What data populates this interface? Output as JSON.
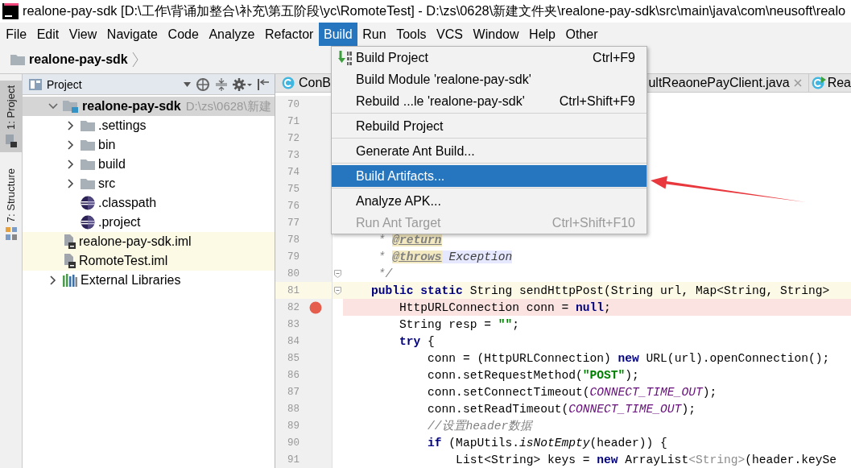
{
  "window": {
    "title": "realone-pay-sdk [D:\\工作\\背诵加整合\\补充\\第五阶段\\yc\\RomoteTest] - D:\\zs\\0628\\新建文件夹\\realone-pay-sdk\\src\\main\\java\\com\\neusoft\\realo"
  },
  "menu_bar": [
    {
      "label": "File",
      "selected": false
    },
    {
      "label": "Edit",
      "selected": false
    },
    {
      "label": "View",
      "selected": false
    },
    {
      "label": "Navigate",
      "selected": false
    },
    {
      "label": "Code",
      "selected": false
    },
    {
      "label": "Analyze",
      "selected": false
    },
    {
      "label": "Refactor",
      "selected": false
    },
    {
      "label": "Build",
      "selected": true
    },
    {
      "label": "Run",
      "selected": false
    },
    {
      "label": "Tools",
      "selected": false
    },
    {
      "label": "VCS",
      "selected": false
    },
    {
      "label": "Window",
      "selected": false
    },
    {
      "label": "Help",
      "selected": false
    },
    {
      "label": "Other",
      "selected": false
    }
  ],
  "breadcrumb": {
    "label": "realone-pay-sdk"
  },
  "tool_windows": [
    {
      "label": "1: Project",
      "selected": true
    },
    {
      "label": "7: Structure",
      "selected": false
    }
  ],
  "project_panel": {
    "title": "Project",
    "tree": [
      {
        "label": "realone-pay-sdk",
        "path": "D:\\zs\\0628\\新建",
        "kind": "module",
        "expanded": true,
        "selected": true,
        "highlighted": false,
        "children": [
          {
            "label": ".settings",
            "kind": "folder",
            "expanded": false,
            "selected": false,
            "highlighted": false
          },
          {
            "label": "bin",
            "kind": "folder",
            "expanded": false,
            "selected": false,
            "highlighted": false
          },
          {
            "label": "build",
            "kind": "folder",
            "expanded": false,
            "selected": false,
            "highlighted": false
          },
          {
            "label": "src",
            "kind": "folder",
            "expanded": false,
            "selected": false,
            "highlighted": false
          },
          {
            "label": ".classpath",
            "kind": "eclipse_file",
            "selected": false,
            "highlighted": false
          },
          {
            "label": ".project",
            "kind": "eclipse_file",
            "selected": false,
            "highlighted": false
          }
        ]
      },
      {
        "label": "realone-pay-sdk.iml",
        "kind": "iml",
        "selected": false,
        "highlighted": true
      },
      {
        "label": "RomoteTest.iml",
        "kind": "iml",
        "selected": false,
        "highlighted": true
      },
      {
        "label": "External Libraries",
        "kind": "libraries",
        "expanded": false,
        "selected": false,
        "highlighted": false
      }
    ]
  },
  "editor": {
    "tabs": [
      {
        "label": "ConB",
        "kind": "class",
        "closable": false
      },
      {
        "label": "ultReaonePayClient.java",
        "kind": "none",
        "closable": true
      },
      {
        "label": "Rea",
        "kind": "runnable_class",
        "closable": false
      }
    ],
    "lines": [
      {
        "number": "70",
        "caret_line": false,
        "breakpoint": false
      },
      {
        "number": "71",
        "caret_line": false,
        "breakpoint": false
      },
      {
        "number": "72",
        "caret_line": false,
        "breakpoint": false
      },
      {
        "number": "73",
        "caret_line": false,
        "breakpoint": false
      },
      {
        "number": "74",
        "caret_line": false,
        "breakpoint": false
      },
      {
        "number": "75",
        "caret_line": false,
        "breakpoint": false
      },
      {
        "number": "76",
        "caret_line": false,
        "breakpoint": false
      },
      {
        "number": "77",
        "caret_line": false,
        "breakpoint": false
      },
      {
        "number": "78",
        "caret_line": false,
        "breakpoint": false,
        "fold_marker": false,
        "tokens": [
          {
            "text": "     * ",
            "kind": "comment"
          },
          {
            "text": "@return",
            "kind": "doctag"
          }
        ]
      },
      {
        "number": "79",
        "caret_line": false,
        "breakpoint": false,
        "fold_marker": false,
        "tokens": [
          {
            "text": "     * ",
            "kind": "comment"
          },
          {
            "text": "@throws",
            "kind": "doctag"
          },
          {
            "text": " Exception",
            "kind": "docref"
          }
        ]
      },
      {
        "number": "80",
        "caret_line": false,
        "breakpoint": false,
        "fold_marker": true,
        "tokens": [
          {
            "text": "     */",
            "kind": "comment"
          }
        ]
      },
      {
        "number": "81",
        "caret_line": true,
        "breakpoint": false,
        "fold_marker": true,
        "tokens": [
          {
            "text": "    public",
            "kind": "keyword"
          },
          {
            "text": " static",
            "kind": "keyword"
          },
          {
            "text": " String sendHttpPost(String url, Map<String, String>",
            "kind": "plain"
          }
        ]
      },
      {
        "number": "82",
        "caret_line": false,
        "breakpoint": true,
        "fold_marker": false,
        "tokens": [
          {
            "text": "        HttpURLConnection conn = ",
            "kind": "plain"
          },
          {
            "text": "null",
            "kind": "keyword"
          },
          {
            "text": ";",
            "kind": "plain"
          }
        ]
      },
      {
        "number": "83",
        "caret_line": false,
        "breakpoint": false,
        "fold_marker": false,
        "tokens": [
          {
            "text": "        String resp = ",
            "kind": "plain"
          },
          {
            "text": "\"\"",
            "kind": "string"
          },
          {
            "text": ";",
            "kind": "plain"
          }
        ]
      },
      {
        "number": "84",
        "caret_line": false,
        "breakpoint": false,
        "fold_marker": false,
        "tokens": [
          {
            "text": "        try",
            "kind": "keyword"
          },
          {
            "text": " {",
            "kind": "plain"
          }
        ]
      },
      {
        "number": "85",
        "caret_line": false,
        "breakpoint": false,
        "fold_marker": false,
        "tokens": [
          {
            "text": "            conn = (HttpURLConnection) ",
            "kind": "plain"
          },
          {
            "text": "new",
            "kind": "keyword"
          },
          {
            "text": " URL(url).openConnection();",
            "kind": "plain"
          }
        ]
      },
      {
        "number": "86",
        "caret_line": false,
        "breakpoint": false,
        "fold_marker": false,
        "tokens": [
          {
            "text": "            conn.setRequestMethod(",
            "kind": "plain"
          },
          {
            "text": "\"POST\"",
            "kind": "string"
          },
          {
            "text": ");",
            "kind": "plain"
          }
        ]
      },
      {
        "number": "87",
        "caret_line": false,
        "breakpoint": false,
        "fold_marker": false,
        "tokens": [
          {
            "text": "            conn.setConnectTimeout(",
            "kind": "plain"
          },
          {
            "text": "CONNECT_TIME_OUT",
            "kind": "constant"
          },
          {
            "text": ");",
            "kind": "plain"
          }
        ]
      },
      {
        "number": "88",
        "caret_line": false,
        "breakpoint": false,
        "fold_marker": false,
        "tokens": [
          {
            "text": "            conn.setReadTimeout(",
            "kind": "plain"
          },
          {
            "text": "CONNECT_TIME_OUT",
            "kind": "constant"
          },
          {
            "text": ");",
            "kind": "plain"
          }
        ]
      },
      {
        "number": "89",
        "caret_line": false,
        "breakpoint": false,
        "fold_marker": false,
        "tokens": [
          {
            "text": "            //设置header数据",
            "kind": "comment"
          }
        ]
      },
      {
        "number": "90",
        "caret_line": false,
        "breakpoint": false,
        "fold_marker": false,
        "tokens": [
          {
            "text": "            if",
            "kind": "keyword"
          },
          {
            "text": " (MapUtils.",
            "kind": "plain"
          },
          {
            "text": "isNotEmpty",
            "kind": "static_call"
          },
          {
            "text": "(header)) {",
            "kind": "plain"
          }
        ]
      },
      {
        "number": "91",
        "caret_line": false,
        "breakpoint": false,
        "fold_marker": false,
        "tokens": [
          {
            "text": "                List<String> keys = ",
            "kind": "plain"
          },
          {
            "text": "new",
            "kind": "keyword"
          },
          {
            "text": " ArrayList",
            "kind": "plain"
          },
          {
            "text": "<String>",
            "kind": "redundant"
          },
          {
            "text": "(header.keySe",
            "kind": "plain"
          }
        ]
      }
    ]
  },
  "popup_menu": {
    "items": [
      {
        "kind": "item_with_icon",
        "label": "Build Project",
        "shortcut": "Ctrl+F9",
        "selected": false,
        "disabled": false
      },
      {
        "kind": "item",
        "label": "Build Module 'realone-pay-sdk'",
        "selected": false,
        "disabled": false
      },
      {
        "kind": "item",
        "label": "Rebuild ...le 'realone-pay-sdk'",
        "shortcut": "Ctrl+Shift+F9",
        "selected": false,
        "disabled": false
      },
      {
        "kind": "separator"
      },
      {
        "kind": "item",
        "label": "Rebuild Project",
        "selected": false,
        "disabled": false
      },
      {
        "kind": "separator"
      },
      {
        "kind": "item",
        "label": "Generate Ant Build...",
        "selected": false,
        "disabled": false
      },
      {
        "kind": "separator"
      },
      {
        "kind": "item",
        "label": "Build Artifacts...",
        "selected": true,
        "disabled": false
      },
      {
        "kind": "separator"
      },
      {
        "kind": "item",
        "label": "Analyze APK...",
        "selected": false,
        "disabled": false
      },
      {
        "kind": "item",
        "label": "Run Ant Target",
        "shortcut": "Ctrl+Shift+F10",
        "selected": false,
        "disabled": true
      }
    ]
  }
}
